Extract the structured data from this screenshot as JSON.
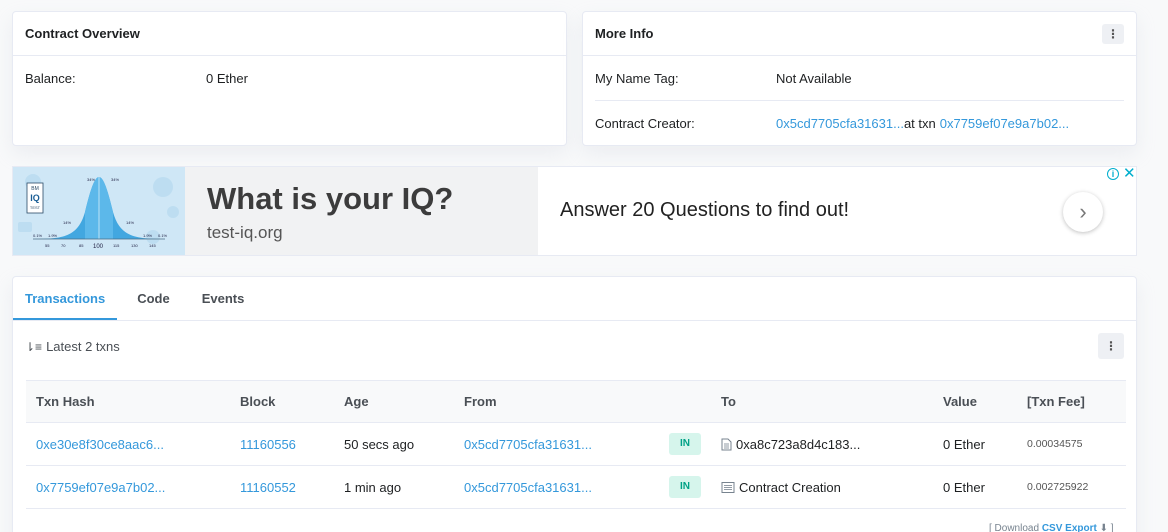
{
  "overview": {
    "title": "Contract Overview",
    "balance_label": "Balance:",
    "balance_value": "0 Ether"
  },
  "more_info": {
    "title": "More Info",
    "name_tag_label": "My Name Tag:",
    "name_tag_value": "Not Available",
    "creator_label": "Contract Creator:",
    "creator_address": "0x5cd7705cfa31631...",
    "creator_at_txn": "at txn",
    "creator_txn": "0x7759ef07e9a7b02..."
  },
  "ad": {
    "headline": "What is your IQ?",
    "site": "test-iq.org",
    "tagline": "Answer 20 Questions to find out!",
    "graph_labels": {
      "logo_top": "BM",
      "logo_main": "IQ",
      "logo_bottom": "TEST",
      "pct_34": "34%",
      "pct_14": "14%",
      "pct_2": "1.9%",
      "pct_01": "0.1%",
      "axis_100": "100",
      "axis_55": "55",
      "axis_70": "70",
      "axis_85": "85",
      "axis_115": "115",
      "axis_130": "130",
      "axis_145": "145"
    }
  },
  "tabs": [
    {
      "label": "Transactions"
    },
    {
      "label": "Code"
    },
    {
      "label": "Events"
    }
  ],
  "tx_summary": "Latest 2 txns",
  "table": {
    "headers": [
      "Txn Hash",
      "Block",
      "Age",
      "From",
      "",
      "To",
      "Value",
      "[Txn Fee]"
    ],
    "rows": [
      {
        "hash": "0xe30e8f30ce8aac6...",
        "block": "11160556",
        "age": "50 secs ago",
        "from": "0x5cd7705cfa31631...",
        "direction": "IN",
        "to": "0xa8c723a8d4c183...",
        "value": "0 Ether",
        "fee": "0.00034575"
      },
      {
        "hash": "0x7759ef07e9a7b02...",
        "block": "11160552",
        "age": "1 min ago",
        "from": "0x5cd7705cfa31631...",
        "direction": "IN",
        "to": "Contract Creation",
        "value": "0 Ether",
        "fee": "0.002725922"
      }
    ]
  },
  "footer": {
    "download_prefix": "[ Download",
    "csv_label": "CSV Export",
    "download_suffix": "]"
  }
}
